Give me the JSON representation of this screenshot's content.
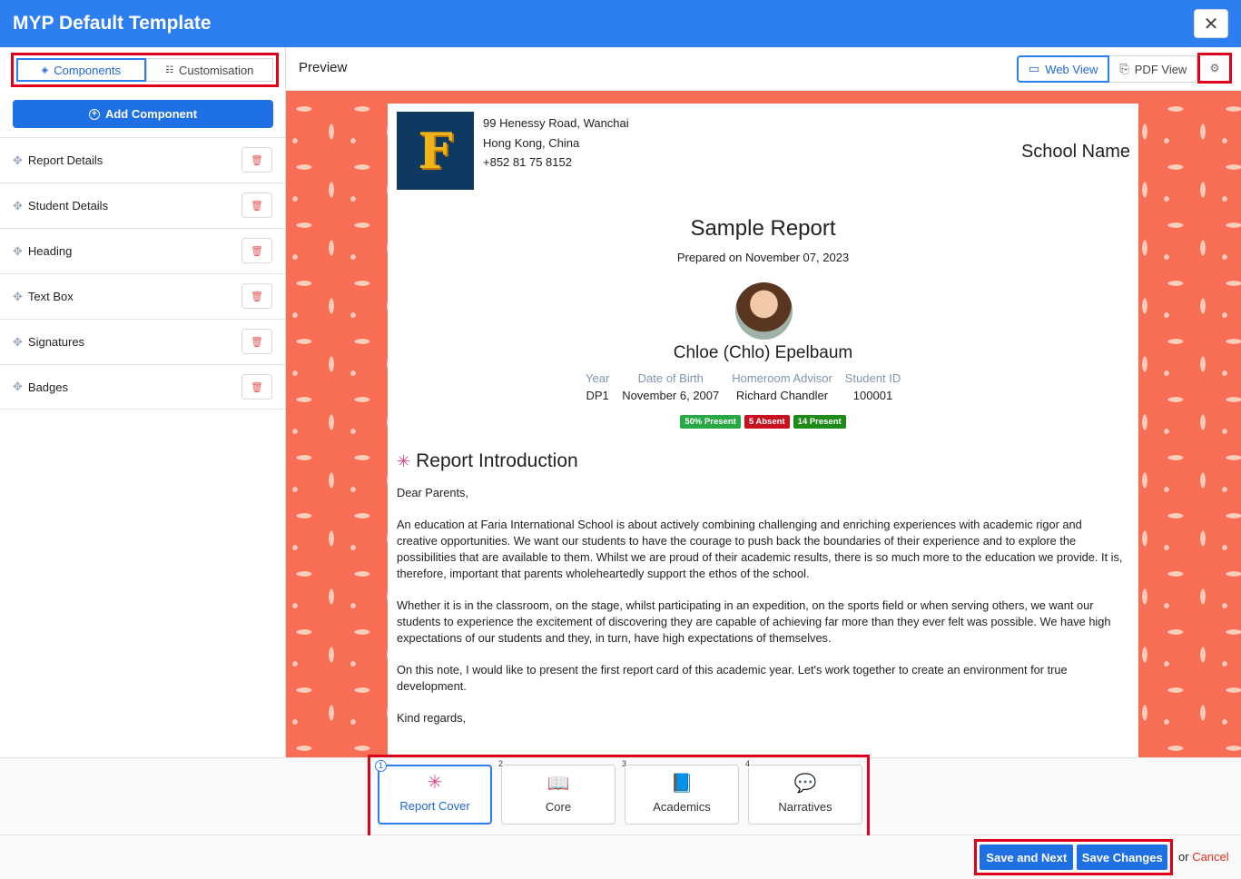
{
  "window": {
    "title": "MYP Default Template",
    "close_icon": "close-icon"
  },
  "left_tabs": {
    "components": "Components",
    "customisation": "Customisation"
  },
  "add_component": "Add Component",
  "components": [
    {
      "label": "Report Details"
    },
    {
      "label": "Student Details"
    },
    {
      "label": "Heading"
    },
    {
      "label": "Text Box"
    },
    {
      "label": "Signatures"
    },
    {
      "label": "Badges"
    }
  ],
  "preview": {
    "label": "Preview",
    "web_view": "Web View",
    "pdf_view": "PDF View"
  },
  "report": {
    "address_line1": "99 Henessy Road, Wanchai",
    "address_line2": "Hong Kong, China",
    "phone": "+852 81 75 8152",
    "school_name": "School Name",
    "logo_letter": "F",
    "title": "Sample Report",
    "prepared": "Prepared on November 07, 2023",
    "student_name": "Chloe (Chlo) Epelbaum",
    "details": [
      {
        "head": "Year",
        "value": "DP1"
      },
      {
        "head": "Date of Birth",
        "value": "November 6, 2007"
      },
      {
        "head": "Homeroom Advisor",
        "value": "Richard Chandler"
      },
      {
        "head": "Student ID",
        "value": "100001"
      }
    ],
    "badges": [
      {
        "text": "50% Present",
        "color": "#28a745"
      },
      {
        "text": "5 Absent",
        "color": "#c8101e"
      },
      {
        "text": "14 Present",
        "color": "#1e8a17"
      }
    ],
    "section_title": "Report Introduction",
    "greeting": "Dear Parents,",
    "para1": "An education at Faria International School is about actively combining challenging and enriching experiences with academic rigor and creative opportunities. We want our students to have the courage to push back the boundaries of their experience and to explore the possibilities that are available to them. Whilst we are proud of their academic results, there is so much more to the education we provide. It is, therefore, important that parents wholeheartedly support the ethos of the school.",
    "para2": "Whether it is in the classroom, on the stage, whilst participating in an expedition, on the sports field or when serving others, we want our students to experience the excitement of discovering they are capable of achieving far more than they ever felt was possible. We have high expectations of our students and they, in turn, have high expectations of themselves.",
    "para3": "On this note, I would like to present the first report card of this academic year. Let's work together to create an environment for true development.",
    "closing": "Kind regards,"
  },
  "steps": [
    {
      "num": "1",
      "label": "Report Cover",
      "icon": "✳"
    },
    {
      "num": "2",
      "label": "Core",
      "icon": "📖"
    },
    {
      "num": "3",
      "label": "Academics",
      "icon": "📘"
    },
    {
      "num": "4",
      "label": "Narratives",
      "icon": "💬"
    }
  ],
  "footer": {
    "save_next": "Save and Next",
    "save_changes": "Save Changes",
    "or": "or",
    "cancel": "Cancel"
  },
  "colors": {
    "accent": "#2d7ef0",
    "pattern": "#f76e55",
    "highlight": "#e0001a"
  }
}
